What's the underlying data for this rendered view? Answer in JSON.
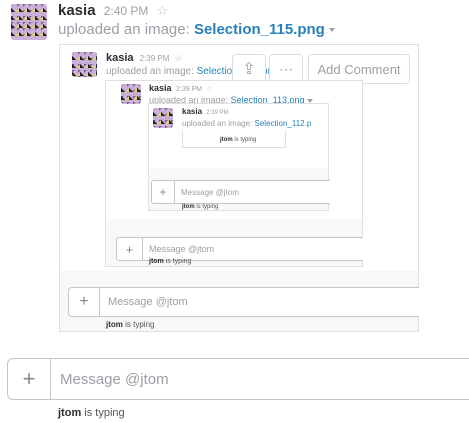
{
  "outer": {
    "user": "kasia",
    "time": "2:40 PM",
    "uploaded_text": "uploaded an image:",
    "filename": "Selection_115.png"
  },
  "level1": {
    "user": "kasia",
    "time": "2:39 PM",
    "uploaded_text": "uploaded an image:",
    "filename": "Selection_114.png",
    "add_comment": "Add Comment",
    "input_placeholder": "Message @jtom",
    "typing_user": "jtom",
    "typing_text": "is typing"
  },
  "level2": {
    "user": "kasia",
    "time": "2:39 PM",
    "uploaded_text": "uploaded an image:",
    "filename": "Selection_113.png",
    "input_placeholder": "Message @jtom",
    "typing_user": "jtom",
    "typing_text": "is typing"
  },
  "level3": {
    "user": "kasia",
    "time": "2:39 PM",
    "uploaded_text": "uploaded an image:",
    "filename": "Selection_112.p",
    "typing_inner_user": "jtom",
    "typing_inner_text": "is typing",
    "input_placeholder": "Message @jtom",
    "typing_user": "jtom",
    "typing_text": "is typing"
  },
  "composer": {
    "plus": "+",
    "placeholder": "Message @jtom",
    "typing_user": "jtom",
    "typing_text": "is typing"
  },
  "icons": {
    "star": "☆",
    "upload": "⇪",
    "more": "⋯"
  }
}
